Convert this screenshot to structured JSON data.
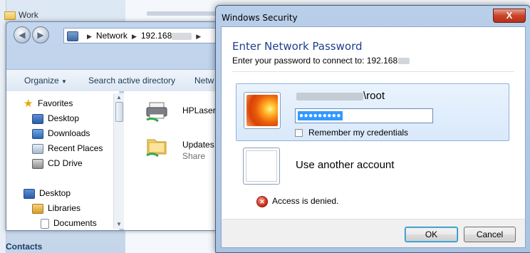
{
  "background": {
    "tree_items": [
      "Work"
    ],
    "contacts_label": "Contacts"
  },
  "explorer": {
    "address": {
      "segment1": "Network",
      "segment2": "192.168"
    },
    "toolbar": {
      "organize_label": "Organize",
      "search_ad_label": "Search active directory",
      "network_label": "Netw"
    },
    "nav": {
      "favorites": "Favorites",
      "desktop": "Desktop",
      "downloads": "Downloads",
      "recent_places": "Recent Places",
      "cd_drive": "CD Drive",
      "desktop2": "Desktop",
      "libraries": "Libraries",
      "documents": "Documents"
    },
    "items": [
      {
        "name": "HPLaserJe",
        "sub": ""
      },
      {
        "name": "Updates",
        "sub": "Share"
      }
    ]
  },
  "dialog": {
    "title": "Windows Security",
    "close_glyph": "X",
    "heading": "Enter Network Password",
    "subheading": "Enter your password to connect to: 192.168",
    "credential": {
      "username_suffix": "\\root",
      "password_mask": "●●●●●●●●●",
      "remember_label": "Remember my credentials",
      "remember_checked": false
    },
    "other_account_label": "Use another account",
    "error_text": "Access is denied.",
    "ok_label": "OK",
    "cancel_label": "Cancel"
  }
}
